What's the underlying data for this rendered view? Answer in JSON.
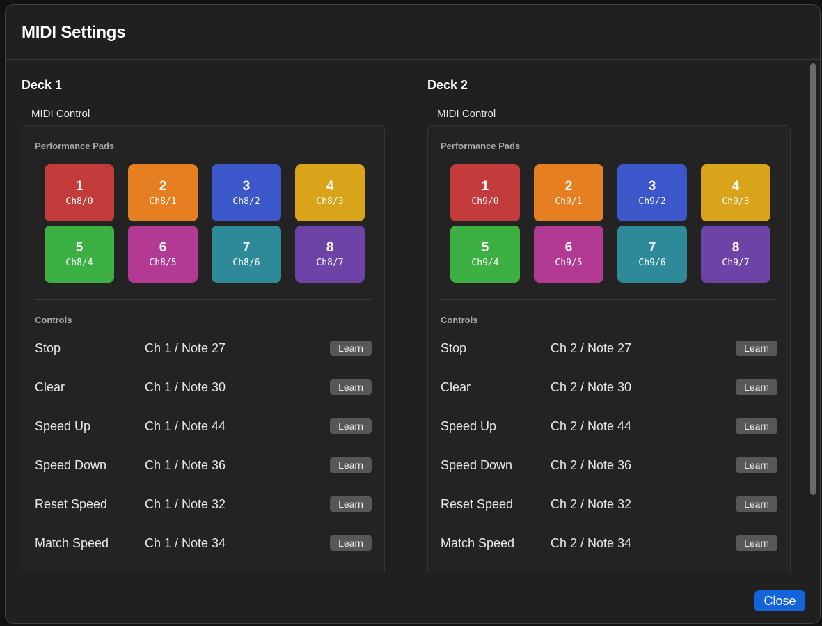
{
  "dialog": {
    "title": "MIDI Settings",
    "close_label": "Close"
  },
  "colors": {
    "pad1": "#c33b3b",
    "pad2": "#e67e22",
    "pad3": "#3b57c9",
    "pad4": "#d9a31a",
    "pad5": "#3cb043",
    "pad6": "#b23a93",
    "pad7": "#2e8a99",
    "pad8": "#6d43a8",
    "accent": "#1264d8"
  },
  "decks": [
    {
      "title": "Deck 1",
      "midi_label": "MIDI Control",
      "pads_label": "Performance Pads",
      "controls_label": "Controls",
      "pads": [
        {
          "num": "1",
          "map": "Ch8/0"
        },
        {
          "num": "2",
          "map": "Ch8/1"
        },
        {
          "num": "3",
          "map": "Ch8/2"
        },
        {
          "num": "4",
          "map": "Ch8/3"
        },
        {
          "num": "5",
          "map": "Ch8/4"
        },
        {
          "num": "6",
          "map": "Ch8/5"
        },
        {
          "num": "7",
          "map": "Ch8/6"
        },
        {
          "num": "8",
          "map": "Ch8/7"
        }
      ],
      "controls": [
        {
          "name": "Stop",
          "value": "Ch 1 / Note 27",
          "learn": "Learn"
        },
        {
          "name": "Clear",
          "value": "Ch 1 / Note 30",
          "learn": "Learn"
        },
        {
          "name": "Speed Up",
          "value": "Ch 1 / Note 44",
          "learn": "Learn"
        },
        {
          "name": "Speed Down",
          "value": "Ch 1 / Note 36",
          "learn": "Learn"
        },
        {
          "name": "Reset Speed",
          "value": "Ch 1 / Note 32",
          "learn": "Learn"
        },
        {
          "name": "Match Speed",
          "value": "Ch 1 / Note 34",
          "learn": "Learn"
        }
      ]
    },
    {
      "title": "Deck 2",
      "midi_label": "MIDI Control",
      "pads_label": "Performance Pads",
      "controls_label": "Controls",
      "pads": [
        {
          "num": "1",
          "map": "Ch9/0"
        },
        {
          "num": "2",
          "map": "Ch9/1"
        },
        {
          "num": "3",
          "map": "Ch9/2"
        },
        {
          "num": "4",
          "map": "Ch9/3"
        },
        {
          "num": "5",
          "map": "Ch9/4"
        },
        {
          "num": "6",
          "map": "Ch9/5"
        },
        {
          "num": "7",
          "map": "Ch9/6"
        },
        {
          "num": "8",
          "map": "Ch9/7"
        }
      ],
      "controls": [
        {
          "name": "Stop",
          "value": "Ch 2 / Note 27",
          "learn": "Learn"
        },
        {
          "name": "Clear",
          "value": "Ch 2 / Note 30",
          "learn": "Learn"
        },
        {
          "name": "Speed Up",
          "value": "Ch 2 / Note 44",
          "learn": "Learn"
        },
        {
          "name": "Speed Down",
          "value": "Ch 2 / Note 36",
          "learn": "Learn"
        },
        {
          "name": "Reset Speed",
          "value": "Ch 2 / Note 32",
          "learn": "Learn"
        },
        {
          "name": "Match Speed",
          "value": "Ch 2 / Note 34",
          "learn": "Learn"
        }
      ]
    }
  ]
}
